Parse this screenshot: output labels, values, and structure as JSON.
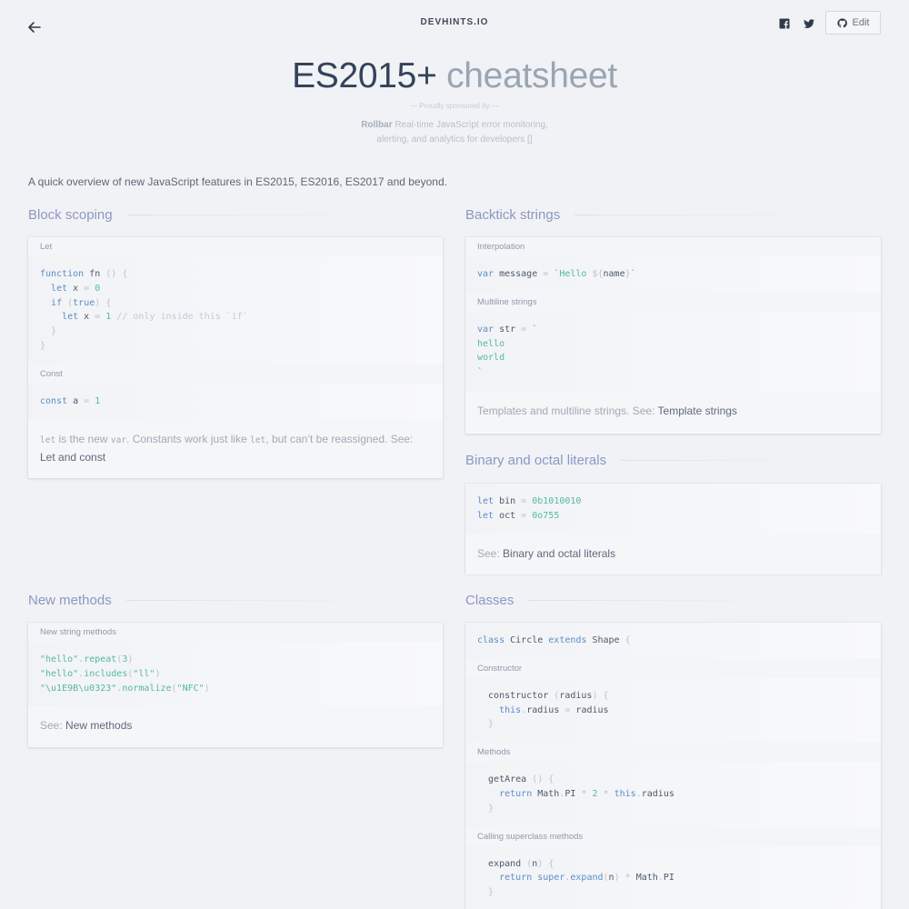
{
  "header": {
    "brand": "DEVHINTS.IO",
    "edit_label": "Edit",
    "title_main": "ES2015+",
    "title_sub": "cheatsheet",
    "sponsor_heading": "— Proudly sponsored by —",
    "sponsor_name": "Rollbar",
    "sponsor_text": "Real-time JavaScript error monitoring, alerting, and analytics for developers []"
  },
  "intro": "A quick overview of new JavaScript features in ES2015, ES2016, ES2017 and beyond.",
  "sections": {
    "block_scoping": {
      "title": "Block scoping",
      "let_heading": "Let",
      "const_heading": "Const",
      "note_prefix_code": "let",
      "note_text_1": " is the new ",
      "note_code_2": "var",
      "note_text_2": ". Constants work just like ",
      "note_code_3": "let",
      "note_text_3": ", but can’t be reassigned. See: ",
      "note_link": "Let and const"
    },
    "backtick_strings": {
      "title": "Backtick strings",
      "interp_heading": "Interpolation",
      "multi_heading": "Multiline strings",
      "note_text": "Templates and multiline strings. See: ",
      "note_link": "Template strings"
    },
    "binary_octal": {
      "title": "Binary and octal literals",
      "note_text": "See: ",
      "note_link": "Binary and octal literals"
    },
    "new_methods": {
      "title": "New methods",
      "heading": "New string methods",
      "note_text": "See: ",
      "note_link": "New methods"
    },
    "classes": {
      "title": "Classes",
      "constructor_heading": "Constructor",
      "methods_heading": "Methods",
      "super_heading": "Calling superclass methods"
    }
  },
  "icons": {
    "back": "arrow-left-icon",
    "facebook": "facebook-icon",
    "twitter": "twitter-icon",
    "github": "github-icon"
  },
  "colors": {
    "background": "#f0f2f5",
    "section_title": "#8e97c5",
    "keyword": "#5b8dc9",
    "literal": "#54b9a0"
  }
}
